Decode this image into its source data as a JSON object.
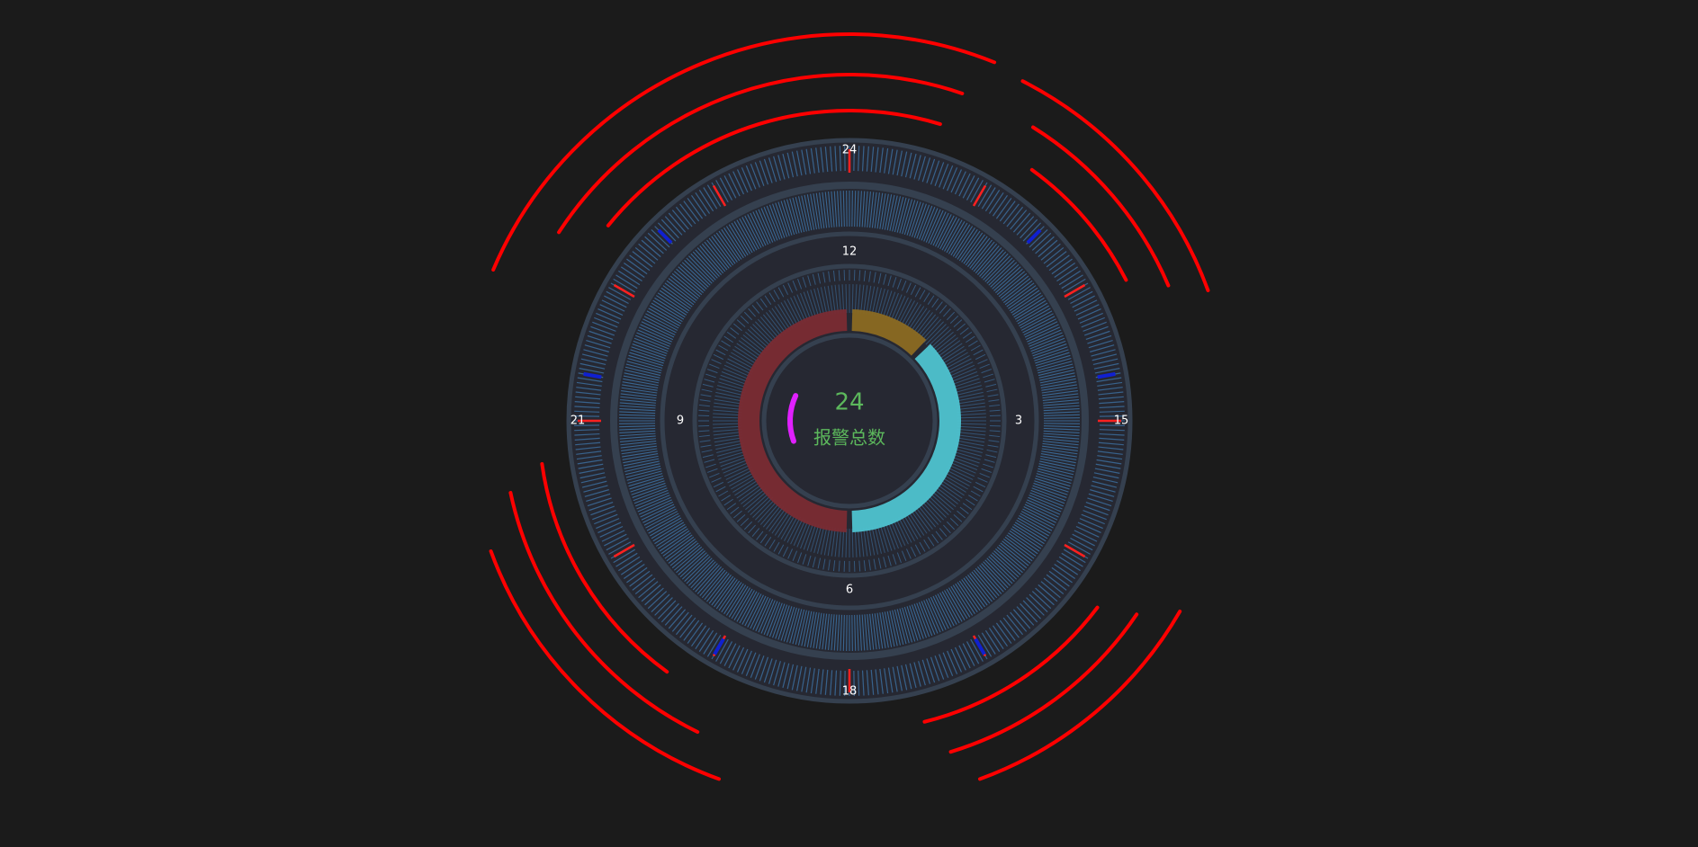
{
  "chart_data": {
    "type": "pie",
    "style": "donut-gauge",
    "center_value": "24",
    "center_label": "报警总数",
    "center_value_color": "#5cb85c",
    "center_label_color": "#5cb85c",
    "slices": [
      {
        "value": 3,
        "color": "#8b6a22"
      },
      {
        "value": 9,
        "color": "#4ec3d0"
      },
      {
        "value": 12,
        "color": "#7a2b33"
      }
    ],
    "inner_ring_ticks": [
      "12",
      "3",
      "6",
      "9"
    ],
    "outer_ring_ticks": [
      "24",
      "15",
      "18",
      "21"
    ],
    "colors": {
      "background": "#1b1b1b",
      "dial_face": "#262832",
      "ring_border": "#35404f",
      "tick_blue": "#3c6d9c",
      "marker_red": "#ff2020",
      "marker_blue": "#1020d0",
      "decor_arcs": "#ff0000",
      "indicator_arc": "#e020ff",
      "tick_label": "#ffffff"
    },
    "indicator_fraction": 0.125
  }
}
